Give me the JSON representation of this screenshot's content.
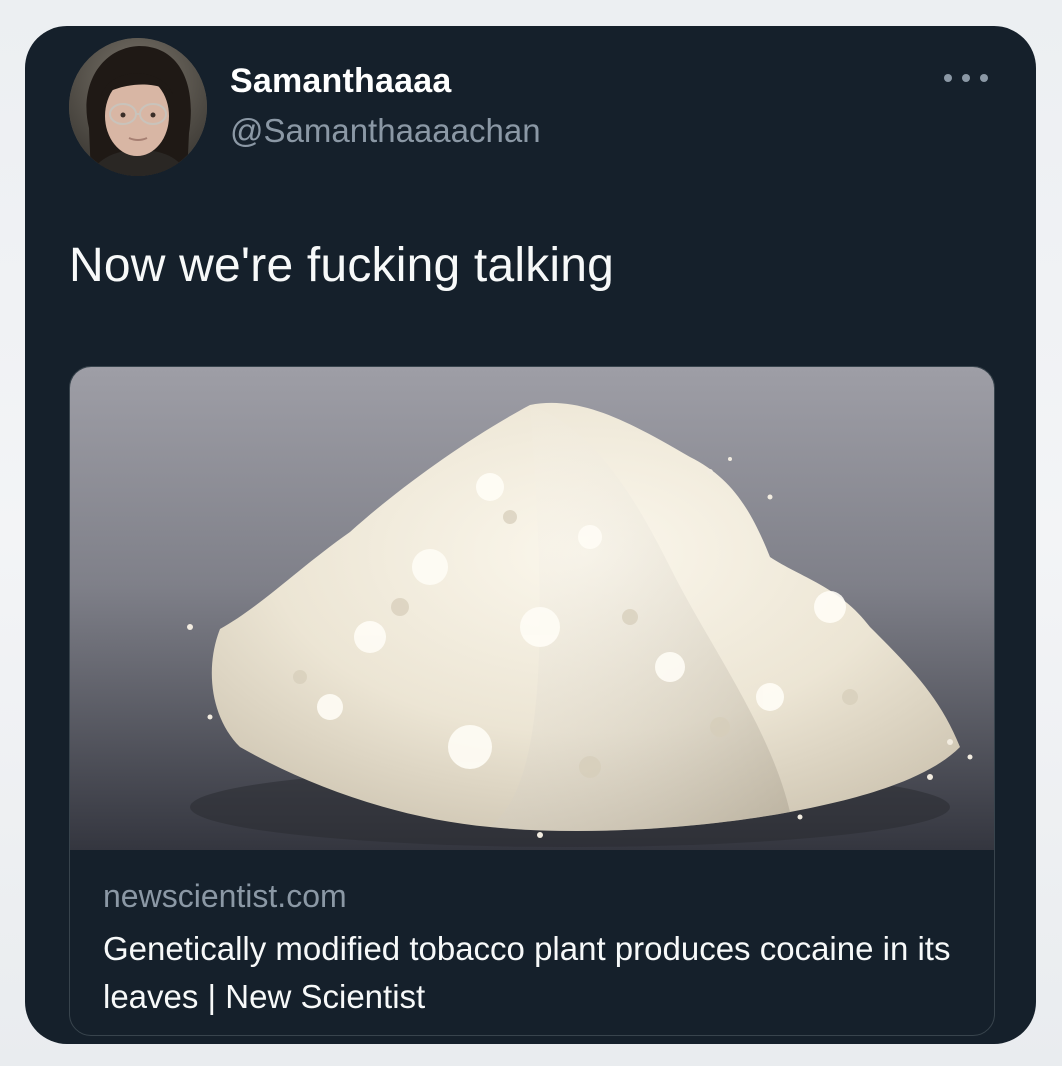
{
  "tweet": {
    "display_name": "Samanthaaaa",
    "handle": "@Samanthaaaachan",
    "text": "Now we're fucking talking",
    "more_icon": "more-horizontal-icon"
  },
  "link_card": {
    "domain": "newscientist.com",
    "title": "Genetically modified tobacco plant produces cocaine in its leaves | New Scientist",
    "image": "white-powder-pile-photo"
  },
  "colors": {
    "card_background": "#15202b",
    "primary_text": "#f7f9f9",
    "secondary_text": "#8b98a5",
    "border": "#38444d"
  }
}
